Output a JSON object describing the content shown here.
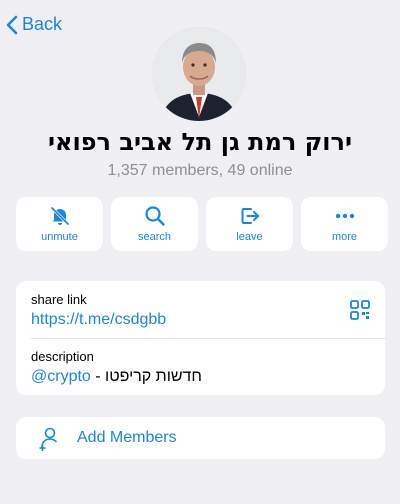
{
  "nav": {
    "back_label": "Back"
  },
  "group": {
    "title": "ירוק רמת גן תל אביב רפואי",
    "subtitle": "1,357 members, 49 online"
  },
  "actions": [
    {
      "label": "unmute",
      "icon": "bell-slash-icon"
    },
    {
      "label": "search",
      "icon": "search-icon"
    },
    {
      "label": "leave",
      "icon": "leave-icon"
    },
    {
      "label": "more",
      "icon": "ellipsis-icon"
    }
  ],
  "info": {
    "share_link_label": "share link",
    "share_link_value": "https://t.me/csdgbb",
    "description_label": "description",
    "description_text": "חדשות קריפטו - ",
    "description_tag": "@crypto"
  },
  "add_members": {
    "label": "Add Members"
  },
  "colors": {
    "accent": "#1a86e0",
    "background": "#efeff4"
  }
}
